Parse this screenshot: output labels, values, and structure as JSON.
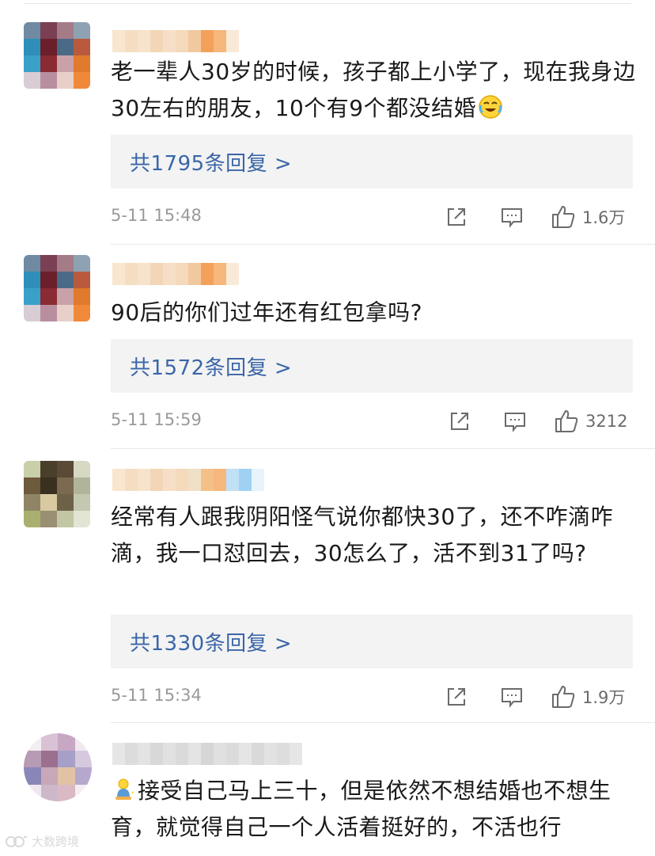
{
  "comments": [
    {
      "text": "老一辈人30岁的时候，孩子都上小学了，现在我身边30左右的朋友，10个有9个都没结婚",
      "replies": "共1795条回复 >",
      "time": "5-11 15:48",
      "likes": "1.6万",
      "emoji": "crying-laughing-emoji"
    },
    {
      "text": "90后的你们过年还有红包拿吗?",
      "replies": "共1572条回复 >",
      "time": "5-11 15:59",
      "likes": "3212"
    },
    {
      "text": "经常有人跟我阴阳怪气说你都快30了，还不咋滴咋滴，我一口怼回去，30怎么了，活不到31了吗?",
      "replies": "共1330条回复 >",
      "time": "5-11 15:34",
      "likes": "1.9万"
    },
    {
      "text": "接受自己马上三十，但是依然不想结婚也不想生育，就觉得自己一个人活着挺好的，不活也行",
      "emoji": "person-sitting-emoji"
    }
  ],
  "icons": {
    "share": "share-icon",
    "comment": "comment-icon",
    "like": "thumbs-up-icon"
  },
  "colors": {
    "reply_link": "#3a66a8",
    "reply_bg": "#f3f3f3",
    "meta_text": "#9a9a9a"
  },
  "watermark": "大数跨境"
}
